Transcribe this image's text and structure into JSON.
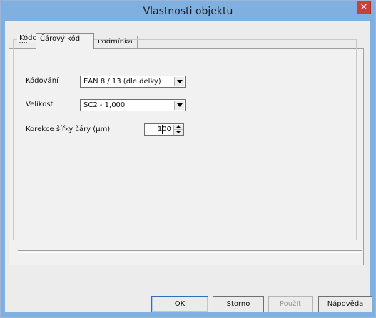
{
  "window": {
    "title": "Vlastnosti objektu",
    "close_glyph": "✕"
  },
  "tabs": [
    {
      "label": "Pole",
      "active": false
    },
    {
      "label": "Čárový kód",
      "active": true
    },
    {
      "label": "Podmínka",
      "active": false
    }
  ],
  "group": {
    "label": "Kódování"
  },
  "fields": {
    "encoding": {
      "label": "Kódování",
      "value": "EAN 8 / 13 (dle délky)"
    },
    "size": {
      "label": "Velikost",
      "value": "SC2  -  1,000"
    },
    "line_width": {
      "label": "Korekce šířky čáry (µm)",
      "value": "100"
    }
  },
  "buttons": {
    "ok": "OK",
    "cancel": "Storno",
    "apply": "Použít",
    "help": "Nápověda"
  },
  "colors": {
    "titlebar": "#7fb0df",
    "close": "#c7403a",
    "face": "#ececec"
  }
}
